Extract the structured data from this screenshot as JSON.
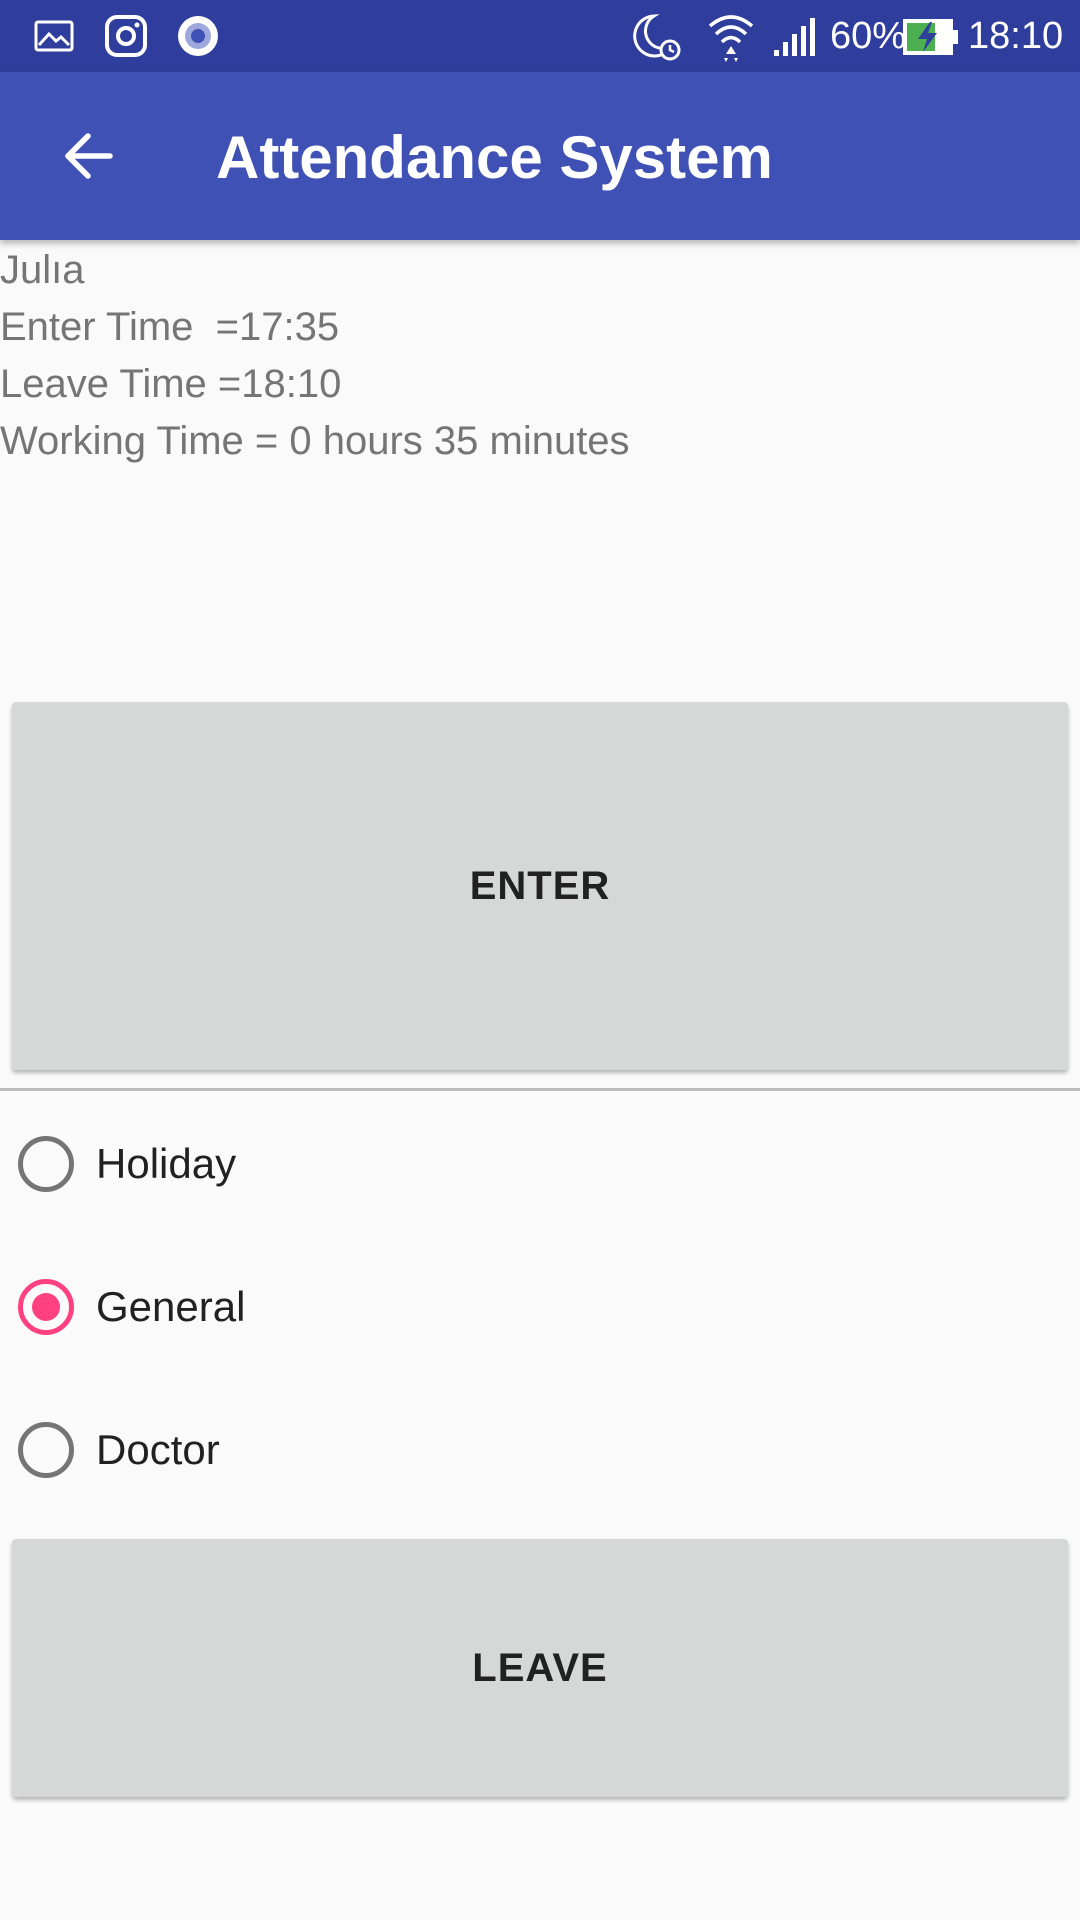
{
  "status_bar": {
    "left_icons": [
      "gallery-icon",
      "instagram-icon",
      "recorder-icon"
    ],
    "right_icons": [
      "night-alarm-icon",
      "wifi-icon",
      "signal-icon",
      "battery-charging-icon"
    ],
    "battery_percent": "60%",
    "time": "18:10",
    "colors": {
      "background": "#2f3d9c",
      "battery_fill": "#4caf50"
    }
  },
  "app_bar": {
    "title": "Attendance System",
    "back_icon": "arrow-back-icon",
    "color": "#3f51b5"
  },
  "info": {
    "user_name": "Julıa",
    "enter_time": "Enter Time  =17:35",
    "leave_time": "Leave Time =18:10",
    "working_time": "Working Time = 0 hours 35 minutes"
  },
  "buttons": {
    "enter_label": "ENTER",
    "leave_label": "LEAVE"
  },
  "leave_type": {
    "options": [
      {
        "label": "Holiday",
        "checked": false
      },
      {
        "label": "General",
        "checked": true
      },
      {
        "label": "Doctor",
        "checked": false
      }
    ],
    "accent_color": "#ff4081"
  }
}
